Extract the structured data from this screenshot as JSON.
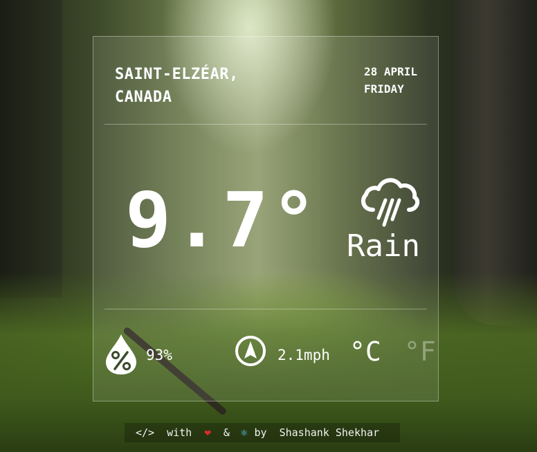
{
  "location": {
    "city": "SAINT-ELZÉAR,",
    "country": "CANADA"
  },
  "date": {
    "day_month": "28 APRIL",
    "weekday": "FRIDAY"
  },
  "current": {
    "temperature": "9.7°",
    "condition": "Rain",
    "condition_icon": "cloud-rain-icon"
  },
  "stats": {
    "humidity": {
      "icon": "humidity-drop-icon",
      "value": "93%"
    },
    "wind": {
      "icon": "wind-compass-icon",
      "value": "2.1mph"
    }
  },
  "units": {
    "celsius": "°C",
    "fahrenheit": "°F",
    "selected": "celsius"
  },
  "footer": {
    "code": "</>",
    "with": "with",
    "heart": "❤",
    "amp": "&",
    "react": "⚛",
    "by": "by",
    "author": "Shashank Shekhar"
  },
  "colors": {
    "heart": "#e22a2a",
    "react": "#61dafb",
    "inactive_unit": "#ffffff59"
  }
}
